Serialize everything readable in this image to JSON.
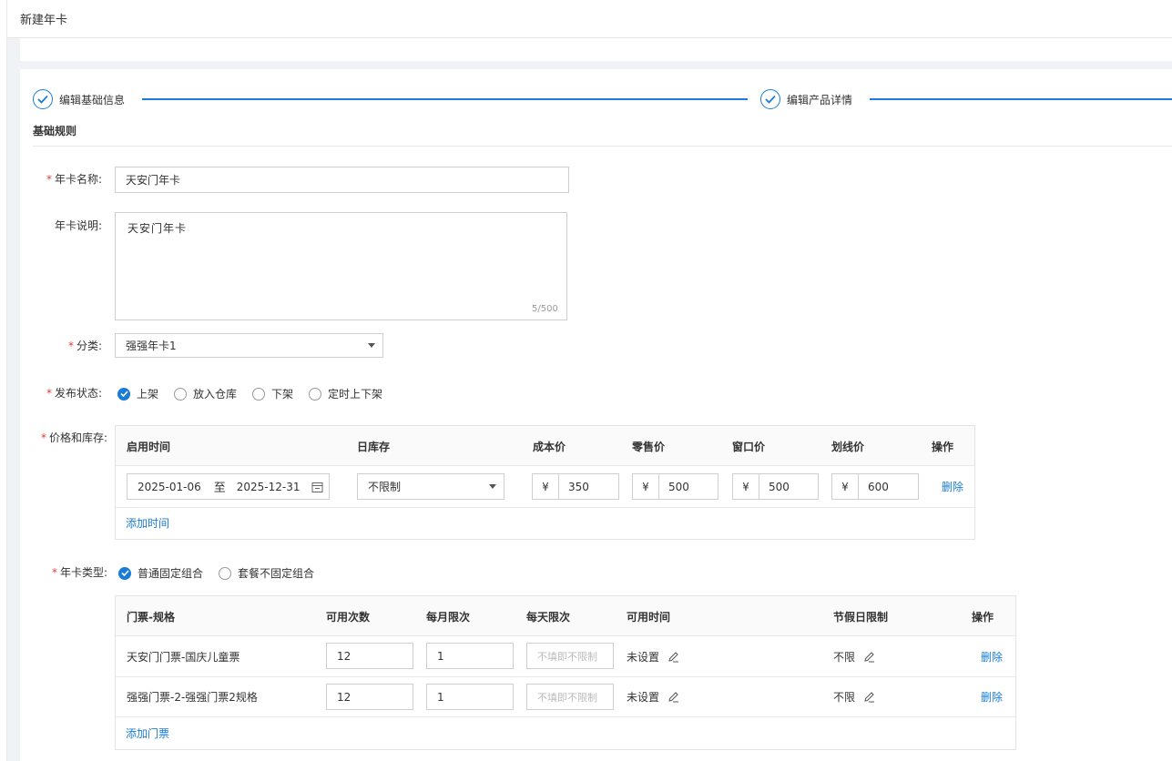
{
  "header": {
    "title": "新建年卡"
  },
  "steps": [
    {
      "label": "编辑基础信息"
    },
    {
      "label": "编辑产品详情"
    }
  ],
  "section": {
    "title": "基础规则"
  },
  "form": {
    "name": {
      "label": "年卡名称:",
      "value": "天安门年卡"
    },
    "desc": {
      "label": "年卡说明:",
      "value": "天安门年卡",
      "counter": "5/500"
    },
    "category": {
      "label": "分类:",
      "value": "强强年卡1"
    },
    "status": {
      "label": "发布状态:",
      "options": [
        "上架",
        "放入仓库",
        "下架",
        "定时上下架"
      ],
      "selected": "上架"
    },
    "price": {
      "label": "价格和库存:",
      "columns": [
        "启用时间",
        "日库存",
        "成本价",
        "零售价",
        "窗口价",
        "划线价",
        "操作"
      ],
      "row": {
        "start": "2025-01-06",
        "to": "至",
        "end": "2025-12-31",
        "stock": "不限制",
        "currency": "¥",
        "cost": "350",
        "retail": "500",
        "window": "500",
        "strike": "600",
        "action": "删除"
      },
      "add": "添加时间"
    },
    "type": {
      "label": "年卡类型:",
      "options": [
        "普通固定组合",
        "套餐不固定组合"
      ],
      "selected": "普通固定组合"
    },
    "tickets": {
      "columns": [
        "门票-规格",
        "可用次数",
        "每月限次",
        "每天限次",
        "可用时间",
        "节假日限制",
        "操作"
      ],
      "placeholder": "不填即不限制",
      "rows": [
        {
          "name": "天安门门票-国庆儿童票",
          "times": "12",
          "monthly": "1",
          "time": "未设置",
          "holiday": "不限",
          "action": "删除"
        },
        {
          "name": "强强门票-2-强强门票2规格",
          "times": "12",
          "monthly": "1",
          "time": "未设置",
          "holiday": "不限",
          "action": "删除"
        }
      ],
      "add": "添加门票"
    }
  },
  "colors": {
    "primary": "#1a7cd6",
    "required": "#e4393c"
  }
}
